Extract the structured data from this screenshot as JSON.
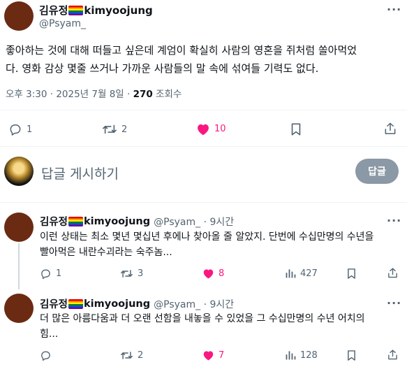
{
  "post": {
    "display_name": "김유정",
    "username_suffix": "kimyoojung",
    "handle": "@Psyam_",
    "text_line1": "좋아하는 것에 대해 떠들고 싶은데 계엄이 확실히 사람의 영혼을 쥐처럼 쏠아먹었",
    "text_line2": "다. 영화 감상 몇줄 쓰거나 가까운 사람들의 말 속에 섞여들 기력도 없다.",
    "timestamp": "오후 3:30 · 2025년 7월 8일 · ",
    "views": "270",
    "views_label": " 조회수",
    "replies": "1",
    "reposts": "2",
    "likes": "10"
  },
  "composer": {
    "placeholder": "답글 게시하기",
    "button": "답글"
  },
  "replies": [
    {
      "display_name": "김유정",
      "username_suffix": "kimyoojung",
      "handle_time": "@Psyam_ · 9시간",
      "text_line1": "이런 상태는 최소 몇년 몇십년 후에나 찾아올 줄 알았지. 단번에 수십만명의 수년을",
      "text_line2": "빨아먹은 내란수괴라는 숙주놈...",
      "replies": "1",
      "reposts": "3",
      "likes": "8",
      "views": "427"
    },
    {
      "display_name": "김유정",
      "username_suffix": "kimyoojung",
      "handle_time": "@Psyam_ · 9시간",
      "text_line1": "더 많은 아름다움과 더 오랜 선함을 내놓을 수 있었을 그 수십만명의 수년 어치의",
      "text_line2": "힘...",
      "replies": "",
      "reposts": "2",
      "likes": "7",
      "views": "128"
    }
  ],
  "colors": {
    "like": "#f91880",
    "muted": "#536471",
    "text": "#0f1419",
    "avatar": "#6b2a12",
    "button_disabled": "#8b98a5"
  },
  "icons": [
    "reply-icon",
    "repost-icon",
    "heart-icon",
    "bookmark-icon",
    "share-icon",
    "views-icon",
    "more-icon"
  ]
}
